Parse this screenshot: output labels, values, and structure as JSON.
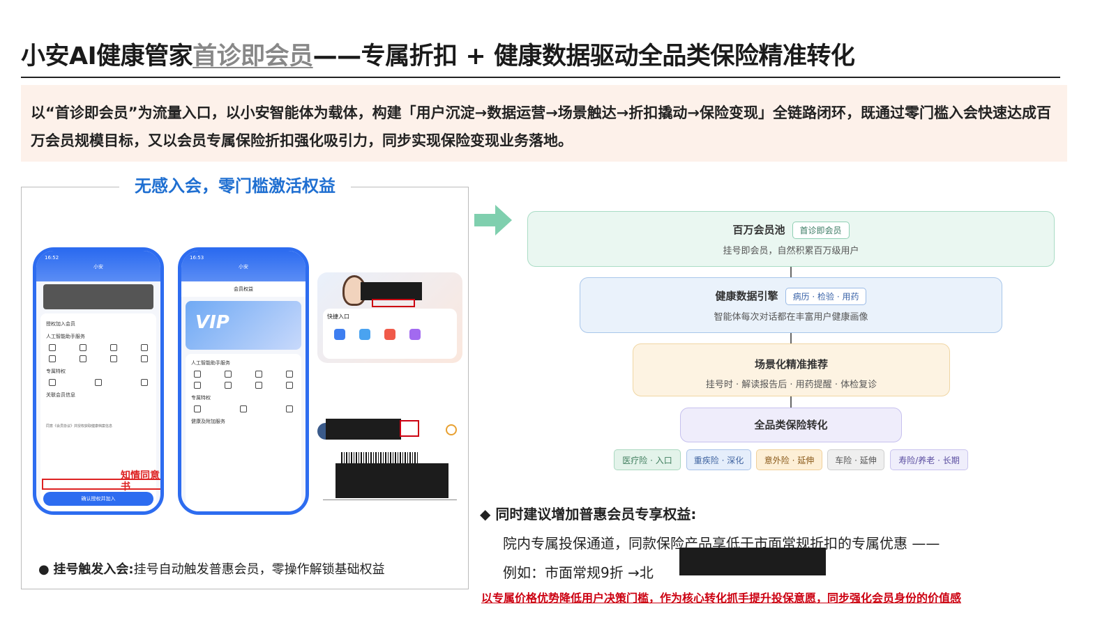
{
  "title": {
    "part1": "小安AI健康管家",
    "highlight": "首诊即会员",
    "part2": "——专属折扣 + 健康数据驱动全品类保险精准转化"
  },
  "intro": "以“首诊即会员”为流量入口，以小安智能体为载体，构建「用户沉淀→数据运营→场景触达→折扣撬动→保险变现」全链路闭环，既通过零门槛入会快速达成百万会员规模目标，又以会员专属保险折扣强化吸引力，同步实现保险变现业务落地。",
  "left_panel": {
    "caption": "无感入会，零门槛激活权益",
    "phone1": {
      "time": "16:52",
      "title": "小安",
      "header": "授权加入会员",
      "section1": "人工智能助手服务",
      "section2": "专属特权",
      "section3": "关联会员信息",
      "consent": "同意《会员协议》并授权获取健康档案信息",
      "button": "确认授权并加入"
    },
    "phone2": {
      "time": "16:53",
      "title": "小安",
      "subtitle": "会员权益",
      "vip": "VIP",
      "section1": "人工智能助手服务",
      "section2": "专属特权",
      "section3": "健康及附加服务"
    },
    "card": {
      "quick_entry": "快捷入口"
    },
    "red_label": "知情同意书",
    "bullet_bold": "挂号触发入会:",
    "bullet_text": "挂号自动触发普惠会员，零操作解锁基础权益"
  },
  "flow": {
    "layer1": {
      "title": "百万会员池",
      "tag": "首诊即会员",
      "sub": "挂号即会员，自然积累百万级用户"
    },
    "layer2": {
      "title": "健康数据引擎",
      "tag": "病历 · 检验 · 用药",
      "sub": "智能体每次对话都在丰富用户健康画像"
    },
    "layer3": {
      "title": "场景化精准推荐",
      "sub": "挂号时 · 解读报告后 · 用药提醒 · 体检复诊"
    },
    "layer4": {
      "title": "全品类保险转化"
    },
    "chips": [
      "医疗险 · 入口",
      "重疾险 · 深化",
      "意外险 · 延伸",
      "车险 · 延伸",
      "寿险/养老 · 长期"
    ]
  },
  "benefits": {
    "heading": "同时建议增加普惠会员专享权益:",
    "line1": "院内专属投保通道，同款保险产品享低于市面常规折扣的专属优惠 ——",
    "line2": "例如：市面常规9折 →北"
  },
  "conclusion": "以专属价格优势降低用户决策门槛，作为核心转化抓手提升投保意愿，同步强化会员身份的价值感",
  "colors": {
    "accent": "#1f6fd1",
    "red": "#cc0011",
    "arrow": "#7fcfae"
  }
}
